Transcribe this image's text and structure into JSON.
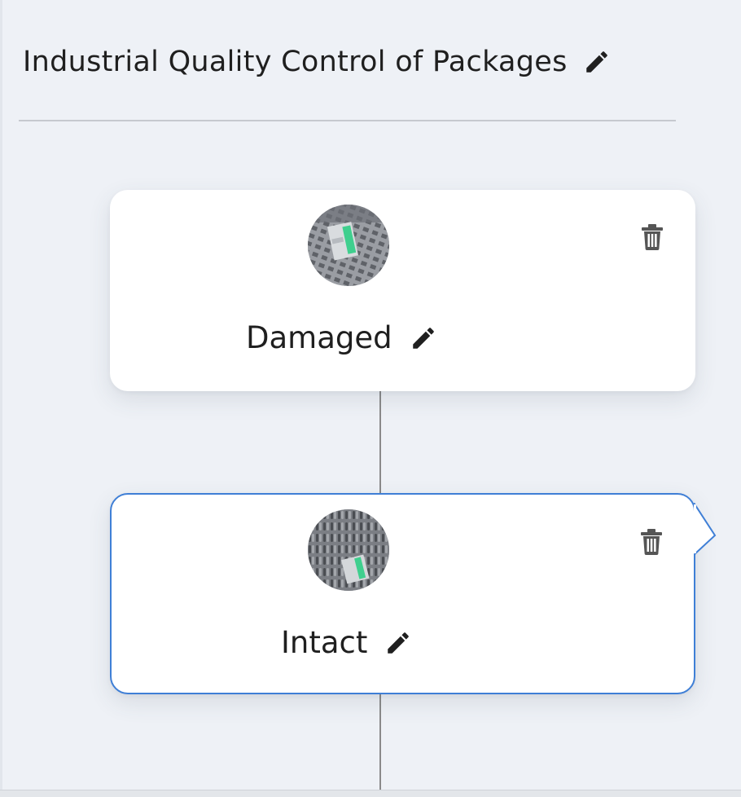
{
  "project": {
    "title": "Industrial Quality Control of Packages",
    "edit_icon": "pencil-icon"
  },
  "classes": [
    {
      "label": "Damaged",
      "thumbnail": "package-on-conveyor-image",
      "delete_icon": "trash-icon",
      "edit_icon": "pencil-icon",
      "selected": false
    },
    {
      "label": "Intact",
      "thumbnail": "package-on-conveyor-image",
      "delete_icon": "trash-icon",
      "edit_icon": "pencil-icon",
      "selected": true
    }
  ],
  "colors": {
    "background": "#eef1f6",
    "card": "#ffffff",
    "selected_border": "#3f7fd6",
    "connector": "#8a8a8a",
    "text": "#1f1f1f",
    "icon": "#555555"
  }
}
